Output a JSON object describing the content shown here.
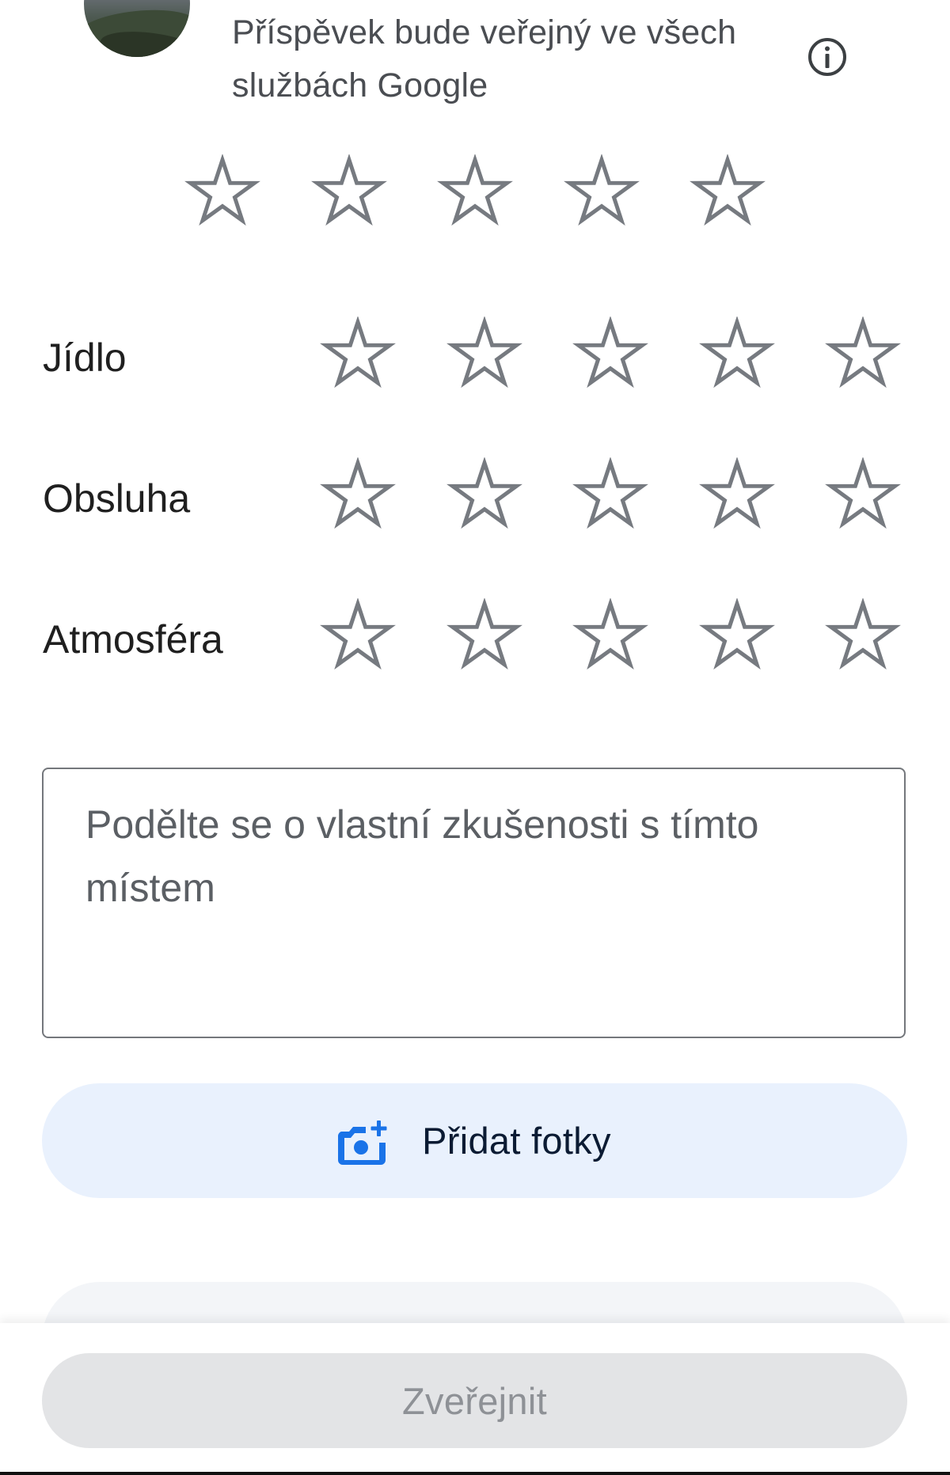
{
  "notice": {
    "text": "Příspěvek bude veřejný ve všech službách Google",
    "info_icon": "info-circle-icon"
  },
  "overall_rating": {
    "max_stars": 5,
    "selected": 0
  },
  "aspect_ratings": [
    {
      "label": "Jídlo",
      "max_stars": 5,
      "selected": 0
    },
    {
      "label": "Obsluha",
      "max_stars": 5,
      "selected": 0
    },
    {
      "label": "Atmosféra",
      "max_stars": 5,
      "selected": 0
    }
  ],
  "review": {
    "placeholder": "Podělte se o vlastní zkušenosti s tímto místem",
    "value": ""
  },
  "add_photos": {
    "label": "Přidat fotky",
    "icon": "add-photo-camera-icon",
    "accent": "#1a73e8",
    "background": "#e9f1fd"
  },
  "publish": {
    "label": "Zveřejnit",
    "enabled": false
  },
  "colors": {
    "star_outline": "#767a80",
    "text_primary": "#1f1f1f",
    "text_secondary": "#4a4d52"
  }
}
